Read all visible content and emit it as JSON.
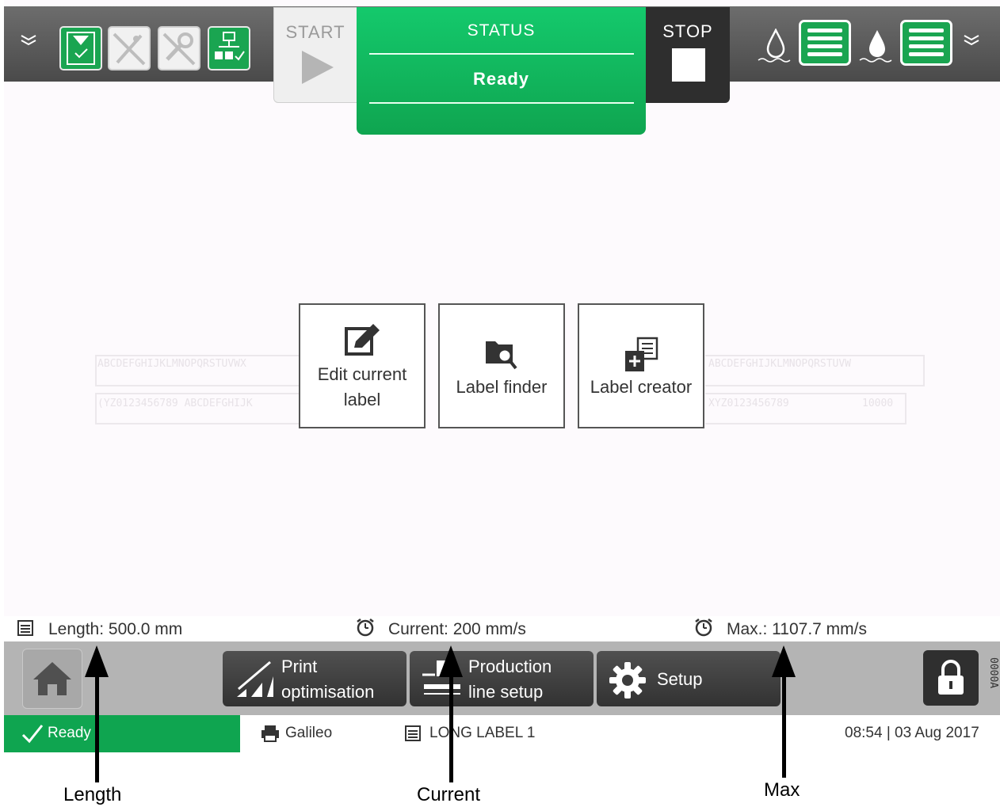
{
  "topbar": {
    "icons_left": [
      "chevron-down-icon",
      "job-ready-icon",
      "usb-disconnected-icon",
      "tools-disabled-icon",
      "network-status-icon"
    ],
    "start_label": "START",
    "status_title": "STATUS",
    "status_value": "Ready",
    "stop_label": "STOP",
    "icons_right": [
      "ink-drop-icon",
      "ink-level-icon",
      "solvent-drop-icon",
      "solvent-level-icon",
      "chevron-down-icon"
    ],
    "accent_color": "#12b862"
  },
  "preview": {
    "row1_left": "ABCDEFGHIJKLMNOPQRSTUVWX",
    "row1_right": "ABCDEFGHIJKLMNOPQRSTUVW",
    "row2_left": "(YZ0123456789 ABCDEFGHIJK",
    "row2_right": "XYZ0123456789",
    "row2_counter": "10000"
  },
  "actions": [
    {
      "label_line1": "Edit current",
      "label_line2": "label",
      "icon": "edit-icon"
    },
    {
      "label": "Label finder",
      "icon": "folder-search-icon"
    },
    {
      "label": "Label creator",
      "icon": "new-label-icon"
    }
  ],
  "info": {
    "length": "Length: 500.0 mm",
    "current": "Current: 200 mm/s",
    "max": "Max.: 1107.7 mm/s"
  },
  "nav": {
    "print_opt_line1": "Print",
    "print_opt_line2": "optimisation",
    "prod_line1": "Production",
    "prod_line2": "line setup",
    "setup": "Setup",
    "code": "0000A"
  },
  "statusbar": {
    "ready": "Ready",
    "printer": "Galileo",
    "label": "LONG LABEL 1",
    "datetime": "08:54 | 03 Aug 2017"
  },
  "annotations": {
    "length": "Length",
    "current": "Current",
    "max": "Max"
  }
}
